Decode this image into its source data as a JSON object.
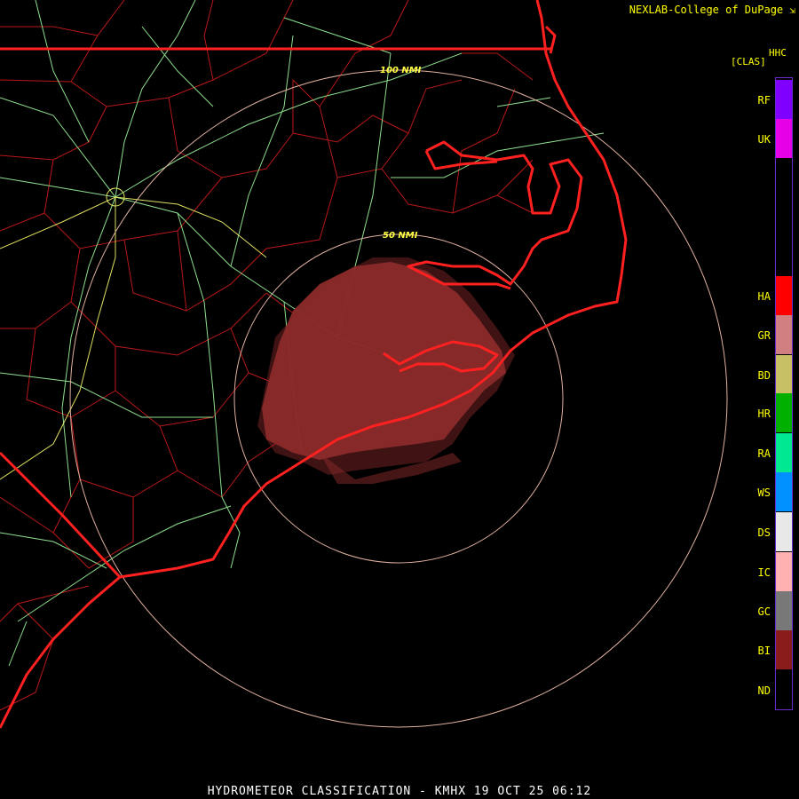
{
  "header": {
    "credit": "NEXLAB-College of DuPage",
    "credit_icon": "arrow-box-icon",
    "product_code": "HHC",
    "product_type": "[CLAS]"
  },
  "rings": [
    {
      "label": "100 NMI"
    },
    {
      "label": "50 NMI"
    }
  ],
  "legend": {
    "items": [
      {
        "code": "RF",
        "color": "#7f00ff"
      },
      {
        "code": "UK",
        "color": "#e600e6"
      },
      {
        "code": "HA",
        "color": "#ff0000"
      },
      {
        "code": "GR",
        "color": "#d08080"
      },
      {
        "code": "BD",
        "color": "#c8c064"
      },
      {
        "code": "HR",
        "color": "#00b000"
      },
      {
        "code": "RA",
        "color": "#00e890"
      },
      {
        "code": "WS",
        "color": "#0090ff"
      },
      {
        "code": "DS",
        "color": "#e8e8e8"
      },
      {
        "code": "IC",
        "color": "#ffb0b0"
      },
      {
        "code": "GC",
        "color": "#787878"
      },
      {
        "code": "BI",
        "color": "#8b1c1c"
      },
      {
        "code": "ND",
        "color": "#000000"
      }
    ]
  },
  "footer": {
    "title": "HYDROMETEOR CLASSIFICATION - KMHX 19 OCT 25 06:12"
  },
  "colors": {
    "coast": "#ff2020",
    "county_lines": "#c01818",
    "roads": "#90e890",
    "range_rings": "#e0b0a0",
    "echo": "#8b2a2a"
  }
}
